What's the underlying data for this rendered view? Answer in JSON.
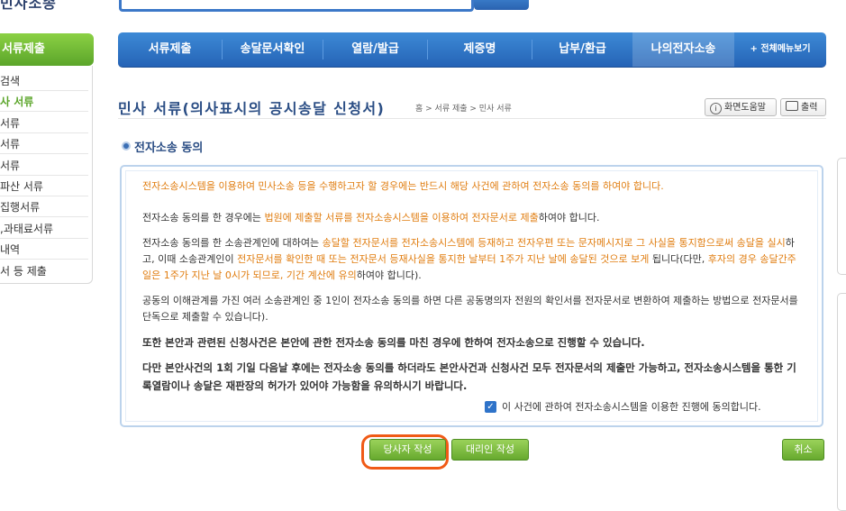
{
  "header": {
    "logo_fragment": "민사조송"
  },
  "sidebar": {
    "title": "서류제출",
    "items": [
      {
        "label": "검색",
        "active": false
      },
      {
        "label": "사 서류",
        "active": true
      },
      {
        "label": "서류",
        "active": false
      },
      {
        "label": "서류",
        "active": false
      },
      {
        "label": "서류",
        "active": false
      },
      {
        "label": "파산 서류",
        "active": false
      },
      {
        "label": "집행서류",
        "active": false
      },
      {
        "label": ",과태료서류",
        "active": false
      },
      {
        "label": "내역",
        "active": false
      },
      {
        "label": "서 등 제출",
        "active": false
      }
    ]
  },
  "nav": {
    "items": [
      "서류제출",
      "송달문서확인",
      "열람/발급",
      "제증명",
      "납부/환급",
      "나의전자소송"
    ],
    "all_menu": "+ 전체메뉴보기"
  },
  "page": {
    "title": "민사 서류(의사표시의 공시송달 신청서)",
    "breadcrumb": "홈 > 서류 제출 > 민사 서류",
    "help_button": "화면도움말",
    "print_button": "출력"
  },
  "section": {
    "title": "전자소송 동의"
  },
  "content": {
    "p1": "전자소송시스템을 이용하여 민사소송 등을 수행하고자 할 경우에는 반드시 해당 사건에 관하여 전자소송 동의를 하여야 합니다.",
    "p2_a": "전자소송 동의를 한 경우에는 ",
    "p2_b": "법원에 제출할 서류를 전자소송시스템을 이용하여 전자문서로 제출",
    "p2_c": "하여야 합니다.",
    "p3_a": "전자소송 동의를 한 소송관계인에 대하여는 ",
    "p3_b": "송달할 전자문서를 전자소송시스템에 등재하고 전자우편 또는 문자메시지로 그 사실을 통지함으로써 송달을 실시",
    "p3_c": "하고, 이때 소송관계인이 ",
    "p3_d": "전자문서를 확인한 때 또는 전자문서 등재사실을 통지한 날부터 1주가 지난 날에 송달된 것으로 보게",
    "p3_e": " 됩니다(다만, ",
    "p3_f": "후자의 경우 송달간주일은 1주가 지난 날 0시가 되므로, 기간 계산에 유의",
    "p3_g": "하여야 합니다).",
    "p4": "공동의 이해관계를 가진 여러 소송관계인 중 1인이 전자소송 동의를 하면 다른 공동명의자 전원의 확인서를 전자문서로 변환하여 제출하는 방법으로 전자문서를 단독으로 제출할 수 있습니다).",
    "p5": "또한 본안과 관련된 신청사건은 본안에 관한 전자소송 동의를 마친 경우에 한하여 전자소송으로 진행할 수 있습니다.",
    "p6": "다만 본안사건의 1회 기일 다음날 후에는 전자소송 동의를 하더라도 본안사건과 신청사건 모두 전자문서의 제출만 가능하고, 전자소송시스템을 통한 기록열람이나 송달은 재판장의 허가가 있어야 가능함을 유의하시기 바랍니다.",
    "agree_label": "이 사건에 관하여 전자소송시스템을 이용한 진행에 동의합니다.",
    "agree_checked": true
  },
  "buttons": {
    "party": "당사자 작성",
    "agent": "대리인 작성",
    "cancel": "취소"
  },
  "colors": {
    "nav_blue": "#2f74c4",
    "green": "#6fb133",
    "orange_text": "#e07d10",
    "highlight": "#f05a16"
  }
}
